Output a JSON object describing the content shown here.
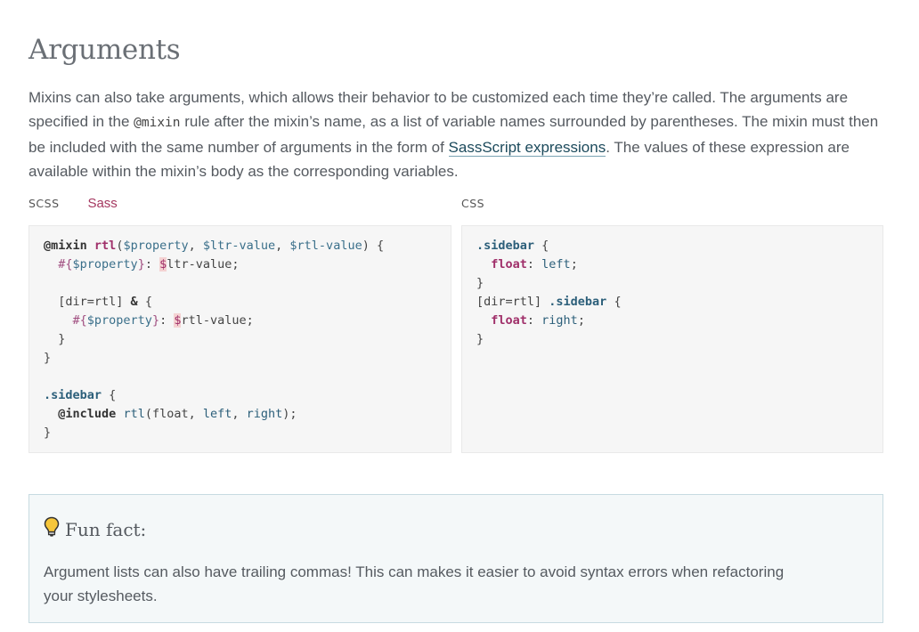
{
  "heading": "Arguments",
  "intro": {
    "p1": "Mixins can also take arguments, which allows their behavior to be customized each time they’re called. The arguments are specified in the ",
    "code": "@mixin",
    "p2": " rule after the mixin’s name, as a list of variable names surrounded by parentheses. The mixin must then be included with the same number of arguments in the form of ",
    "link": "SassScript expressions",
    "p3": ". The values of these expression are available within the mixin’s body as the corresponding variables."
  },
  "tabs": {
    "scss": "SCSS",
    "sass": "Sass",
    "css": "CSS"
  },
  "fun_fact": {
    "title": "Fun fact:",
    "body": "Argument lists can also have trailing commas! This can makes it easier to avoid syntax errors when refactoring your stylesheets.",
    "icon": "lightbulb-icon"
  },
  "colors": {
    "accent": "#a53860",
    "link": "#1c4a5c",
    "callout_bg": "#f4f8f9",
    "code_bg": "#f6f6f6"
  }
}
